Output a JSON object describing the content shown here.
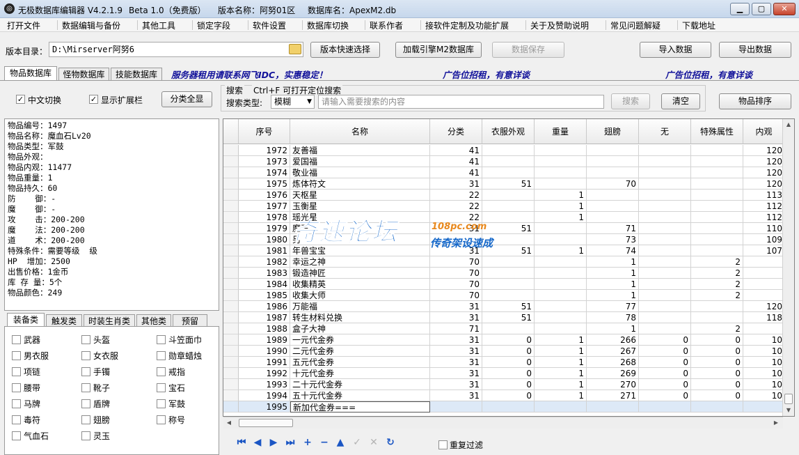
{
  "window": {
    "app_title": "无极数据库编辑器 V4.2.1.9",
    "beta": "Beta 1.0（免费版）",
    "version_name": "版本名称：阿努01区",
    "db_name": "数据库名：ApexM2.db"
  },
  "menu": [
    "打开文件",
    "数据编辑与备份",
    "其他工具",
    "锁定字段",
    "软件设置",
    "数据库切换",
    "联系作者",
    "接软件定制及功能扩展",
    "关于及赞助说明",
    "常见问题解疑",
    "下载地址"
  ],
  "toolbar": {
    "dir_label": "版本目录：",
    "dir_value": "D:\\Mirserver阿努6",
    "quick_select": "版本快速选择",
    "load_engine": "加载引擎M2数据库",
    "save": "数据保存",
    "import": "导入数据",
    "export": "导出数据"
  },
  "tabs": [
    "物品数据库",
    "怪物数据库",
    "技能数据库"
  ],
  "ads": {
    "server": "服务器租用请联系网飞IDC，实惠稳定！",
    "ad1": "广告位招租，有意详谈",
    "ad2": "广告位招租，有意详谈"
  },
  "options": {
    "cn_switch": "中文切换",
    "show_ext": "显示扩展栏",
    "show_all": "分类全显",
    "search_label": "搜索",
    "search_hint": "Ctrl+F 可打开定位搜索",
    "search_type_label": "搜索类型:",
    "search_type_value": "模糊",
    "search_placeholder": "请输入需要搜索的内容",
    "search_btn": "搜索",
    "clear_btn": "清空",
    "sort_btn": "物品排序"
  },
  "item_info": [
    "物品编号：1497",
    "物品名称：魔血石Lv20",
    "物品类型：军鼓",
    "物品外观：",
    "物品内观：11477",
    "物品重量：1",
    "物品持久：60",
    "防    御：-",
    "魔    御：-",
    "攻    击：200-200",
    "魔    法：200-200",
    "道    术：200-200",
    "特殊条件：需要等级  级",
    "HP  增加：2500",
    "出售价格：1金币",
    "库 存 量：5个",
    "物品颜色：249"
  ],
  "cat_tabs": [
    "装备类",
    "触发类",
    "时装生肖类",
    "其他类",
    "预留"
  ],
  "categories": [
    "武器",
    "头盔",
    "斗笠面巾",
    "男衣服",
    "女衣服",
    "勋章蜡烛",
    "项链",
    "手镯",
    "戒指",
    "腰带",
    "靴子",
    "宝石",
    "马牌",
    "盾牌",
    "军鼓",
    "毒符",
    "翅膀",
    "称号",
    "气血石",
    "灵玉"
  ],
  "grid": {
    "headers": [
      "序号",
      "名称",
      "分类",
      "衣服外观",
      "重量",
      "翅膀",
      "无",
      "特殊属性",
      "内观"
    ],
    "rows": [
      [
        "1972",
        "友善福",
        "41",
        "",
        "",
        "",
        "",
        "",
        "120"
      ],
      [
        "1973",
        "爱国福",
        "41",
        "",
        "",
        "",
        "",
        "",
        "120"
      ],
      [
        "1974",
        "敬业福",
        "41",
        "",
        "",
        "",
        "",
        "",
        "120"
      ],
      [
        "1975",
        "炼体符文",
        "31",
        "51",
        "",
        "70",
        "",
        "",
        "120"
      ],
      [
        "1976",
        "天枢星",
        "22",
        "",
        "1",
        "",
        "",
        "",
        "113"
      ],
      [
        "1977",
        "玉衡星",
        "22",
        "",
        "1",
        "",
        "",
        "",
        "112"
      ],
      [
        "1978",
        "瑶光星",
        "22",
        "",
        "1",
        "",
        "",
        "",
        "112"
      ],
      [
        "1979",
        "魔王",
        "31",
        "51",
        "",
        "71",
        "",
        "",
        "110"
      ],
      [
        "1980",
        "另",
        "",
        "",
        "",
        "73",
        "",
        "",
        "109"
      ],
      [
        "1981",
        "年兽宝宝",
        "31",
        "51",
        "1",
        "74",
        "",
        "",
        "107"
      ],
      [
        "1982",
        "幸运之神",
        "70",
        "",
        "",
        "1",
        "",
        "2",
        ""
      ],
      [
        "1983",
        "锻造神匠",
        "70",
        "",
        "",
        "1",
        "",
        "2",
        ""
      ],
      [
        "1984",
        "收集精英",
        "70",
        "",
        "",
        "1",
        "",
        "2",
        ""
      ],
      [
        "1985",
        "收集大师",
        "70",
        "",
        "",
        "1",
        "",
        "2",
        ""
      ],
      [
        "1986",
        "万能福",
        "31",
        "51",
        "",
        "77",
        "",
        "",
        "120"
      ],
      [
        "1987",
        "转生材料兑换",
        "31",
        "51",
        "",
        "78",
        "",
        "",
        "118"
      ],
      [
        "1988",
        "盒子大神",
        "71",
        "",
        "",
        "1",
        "",
        "2",
        ""
      ],
      [
        "1989",
        "一元代金券",
        "31",
        "0",
        "1",
        "266",
        "0",
        "0",
        "10"
      ],
      [
        "1990",
        "二元代金券",
        "31",
        "0",
        "1",
        "267",
        "0",
        "0",
        "10"
      ],
      [
        "1991",
        "五元代金券",
        "31",
        "0",
        "1",
        "268",
        "0",
        "0",
        "10"
      ],
      [
        "1992",
        "十元代金券",
        "31",
        "0",
        "1",
        "269",
        "0",
        "0",
        "10"
      ],
      [
        "1993",
        "二十元代金券",
        "31",
        "0",
        "1",
        "270",
        "0",
        "0",
        "10"
      ],
      [
        "1994",
        "五十元代金券",
        "31",
        "0",
        "1",
        "271",
        "0",
        "0",
        "10"
      ],
      [
        "1995",
        "新加代金券===",
        "",
        "",
        "",
        "",
        "",
        "",
        ""
      ]
    ]
  },
  "bottom": {
    "dup_filter": "重复过滤"
  },
  "watermark": {
    "main": "奇速论坛",
    "site": "108pc.com",
    "sub": "传奇架设速成"
  },
  "colors": {
    "accent_blue": "#1b56c4",
    "ad_blue": "#12129a",
    "selected_row": "#dde9f7"
  }
}
